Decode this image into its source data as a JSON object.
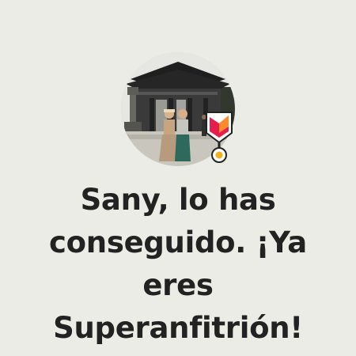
{
  "profile": {
    "avatar_alt": "",
    "badge_icon": "superhost-medal-icon"
  },
  "headline": {
    "text": "Sany, lo has conseguido. ¡Ya eres Superanfitrión!"
  },
  "colors": {
    "background": "#ecece6",
    "text": "#222222",
    "badge_pink": "#e61e4d",
    "badge_orange": "#ff8a2b",
    "badge_yellow": "#f3b11b"
  }
}
